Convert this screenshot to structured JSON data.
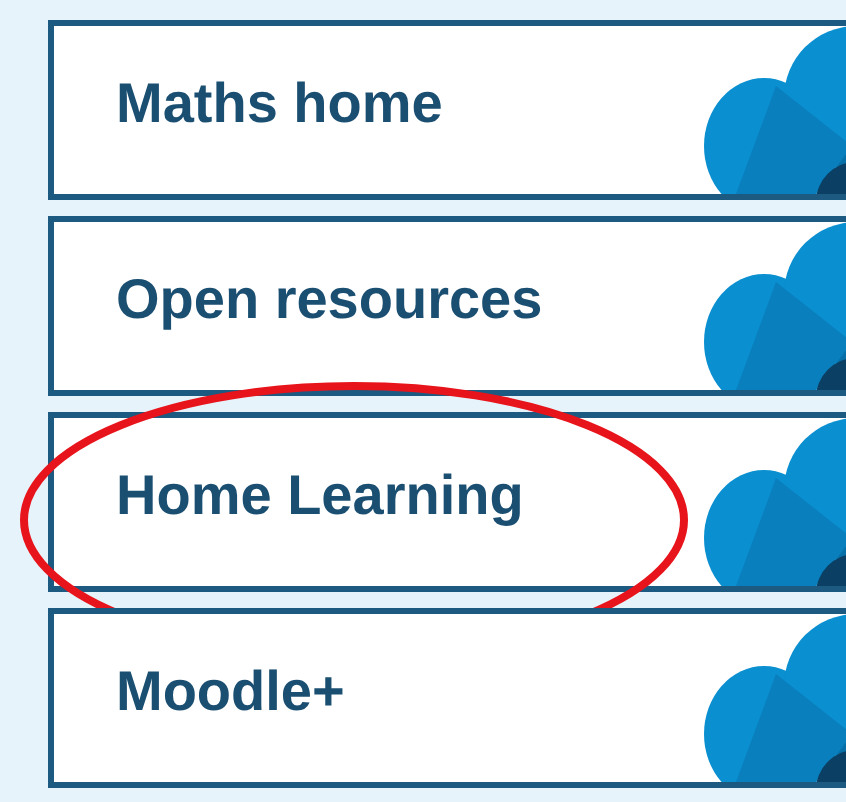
{
  "links": [
    {
      "label": "Maths home",
      "highlighted": false
    },
    {
      "label": "Open resources",
      "highlighted": false
    },
    {
      "label": "Home Learning",
      "highlighted": true
    },
    {
      "label": "Moodle+",
      "highlighted": false
    }
  ]
}
